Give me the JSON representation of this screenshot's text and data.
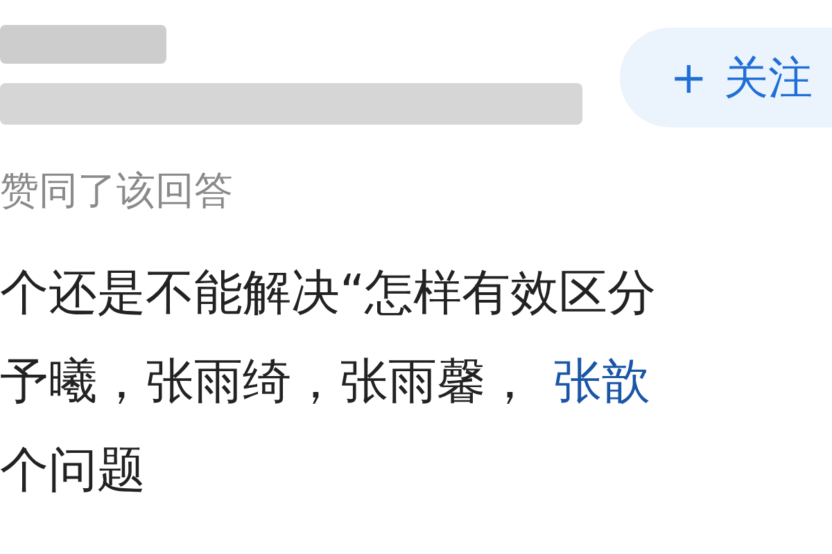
{
  "follow_button": {
    "icon": "+",
    "label": "关注"
  },
  "activity": "赞同了该回答",
  "comment": {
    "lines": [
      {
        "text": "个还是不能解决“怎样有效区分"
      },
      {
        "text": "予曦，张雨绮，张雨馨，",
        "link": "张歆"
      },
      {
        "text": "个问题"
      }
    ]
  }
}
